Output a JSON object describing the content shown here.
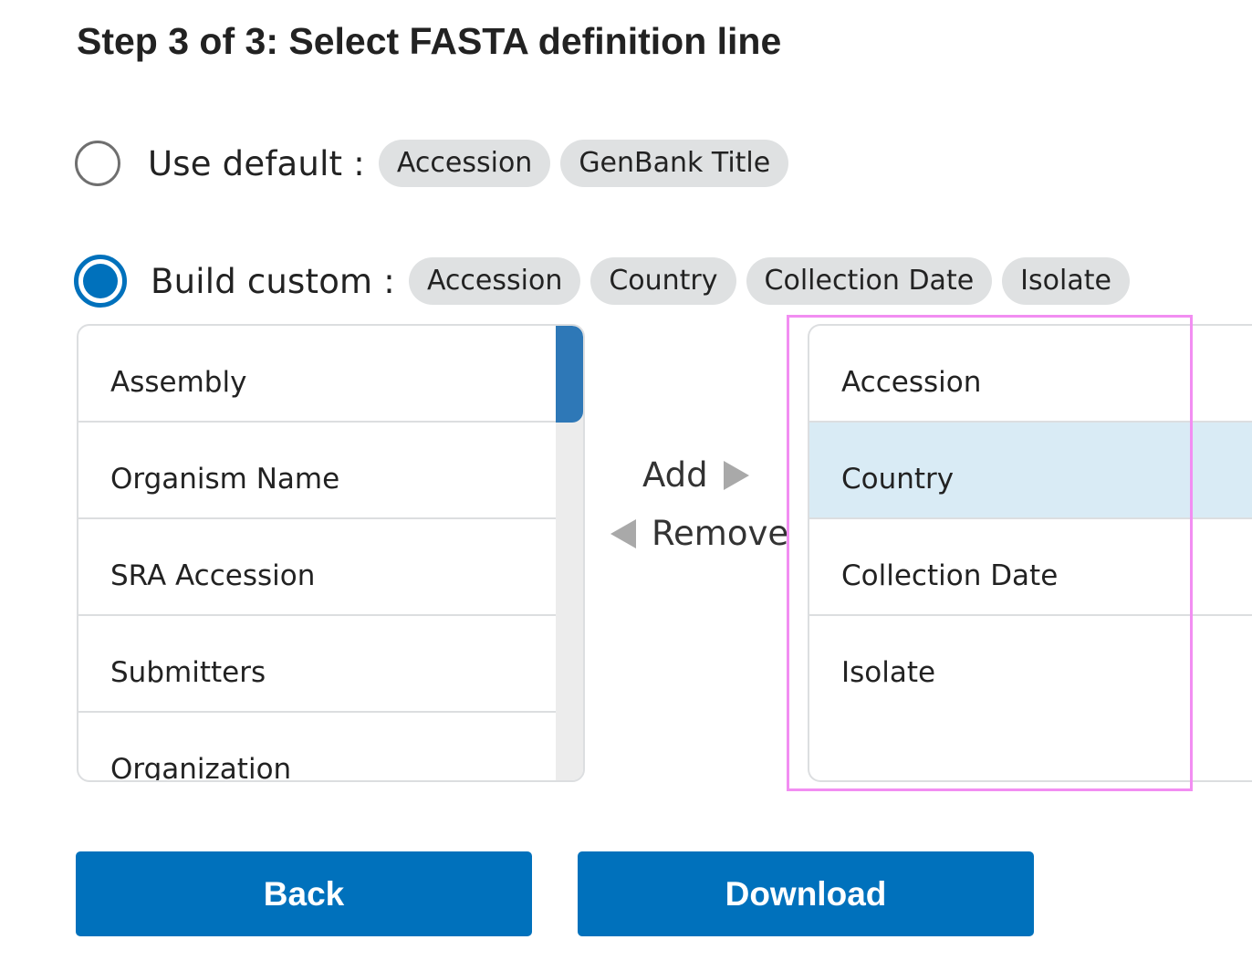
{
  "page_title": "Step 3 of 3: Select FASTA definition line",
  "default_option": {
    "label": "Use default :",
    "selected": false,
    "chips": [
      "Accession",
      "GenBank Title"
    ]
  },
  "custom_option": {
    "label": "Build custom :",
    "selected": true,
    "chips": [
      "Accession",
      "Country",
      "Collection Date",
      "Isolate"
    ]
  },
  "available_fields": {
    "items": [
      "Assembly",
      "Organism Name",
      "SRA Accession",
      "Submitters",
      "Organization"
    ]
  },
  "selected_fields": {
    "items": [
      "Accession",
      "Country",
      "Collection Date",
      "Isolate"
    ],
    "highlighted_item": "Country"
  },
  "controls": {
    "add_label": "Add",
    "remove_label": "Remove"
  },
  "footer": {
    "back_label": "Back",
    "download_label": "Download"
  },
  "colors": {
    "primary": "#0071bc",
    "chip_bg": "#dfe1e2",
    "selected_row": "#d9ebf5",
    "scrollbar_thumb": "#2e78b7",
    "highlight_outline": "#f28ef2"
  }
}
